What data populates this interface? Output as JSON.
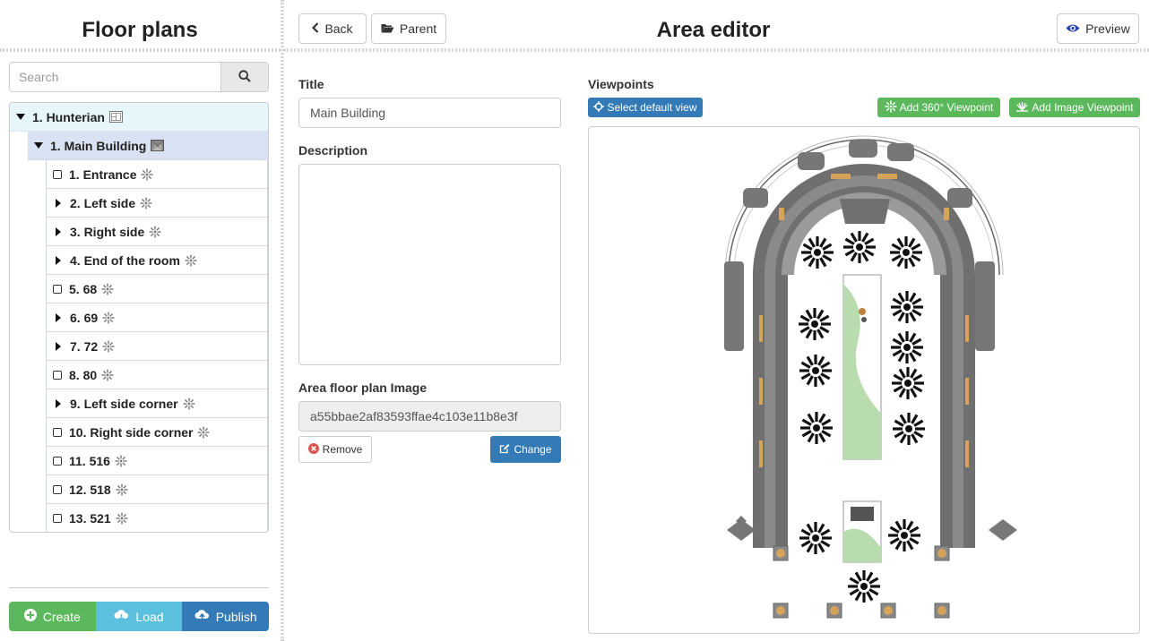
{
  "left_panel": {
    "title": "Floor plans",
    "search": {
      "placeholder": "Search",
      "value": ""
    },
    "tree": {
      "root": {
        "label": "1. Hunterian",
        "icon": "floorplan-icon"
      },
      "area": {
        "label": "1. Main Building",
        "icon": "image-icon"
      },
      "items": [
        {
          "label": "1. Entrance",
          "expander": "leaf",
          "icon": "viewpoint-360-icon"
        },
        {
          "label": "2. Left side",
          "expander": "collapsed",
          "icon": "viewpoint-360-icon"
        },
        {
          "label": "3. Right side",
          "expander": "collapsed",
          "icon": "viewpoint-360-icon"
        },
        {
          "label": "4. End of the room",
          "expander": "collapsed",
          "icon": "viewpoint-360-icon"
        },
        {
          "label": "5. 68",
          "expander": "leaf",
          "icon": "viewpoint-360-icon"
        },
        {
          "label": "6. 69",
          "expander": "collapsed",
          "icon": "viewpoint-360-icon"
        },
        {
          "label": "7. 72",
          "expander": "collapsed",
          "icon": "viewpoint-360-icon"
        },
        {
          "label": "8. 80",
          "expander": "leaf",
          "icon": "viewpoint-360-icon"
        },
        {
          "label": "9. Left side corner",
          "expander": "collapsed",
          "icon": "viewpoint-360-icon"
        },
        {
          "label": "10. Right side corner",
          "expander": "leaf",
          "icon": "viewpoint-360-icon"
        },
        {
          "label": "11. 516",
          "expander": "leaf",
          "icon": "viewpoint-360-icon"
        },
        {
          "label": "12. 518",
          "expander": "leaf",
          "icon": "viewpoint-360-icon"
        },
        {
          "label": "13. 521",
          "expander": "leaf",
          "icon": "viewpoint-360-icon"
        }
      ]
    },
    "buttons": {
      "create": "Create",
      "load": "Load",
      "publish": "Publish"
    }
  },
  "toolbar": {
    "back": "Back",
    "parent": "Parent",
    "preview": "Preview"
  },
  "editor": {
    "title": "Area editor",
    "fields": {
      "title_label": "Title",
      "title_value": "Main Building",
      "description_label": "Description",
      "description_value": "",
      "image_label": "Area floor plan Image",
      "image_value": "a55bbae2af83593ffae4c103e11b8e3f"
    },
    "buttons": {
      "remove": "Remove",
      "change": "Change"
    },
    "viewpoints": {
      "label": "Viewpoints",
      "select_default": "Select default view",
      "add_360": "Add 360° Viewpoint",
      "add_image": "Add Image Viewpoint"
    }
  },
  "colors": {
    "primary": "#337ab7",
    "success": "#5cb85c",
    "info": "#5bc0de",
    "danger": "#d9534f",
    "tree_root_bg": "#e7f6fb",
    "tree_selected_bg": "#d8e2f3"
  }
}
